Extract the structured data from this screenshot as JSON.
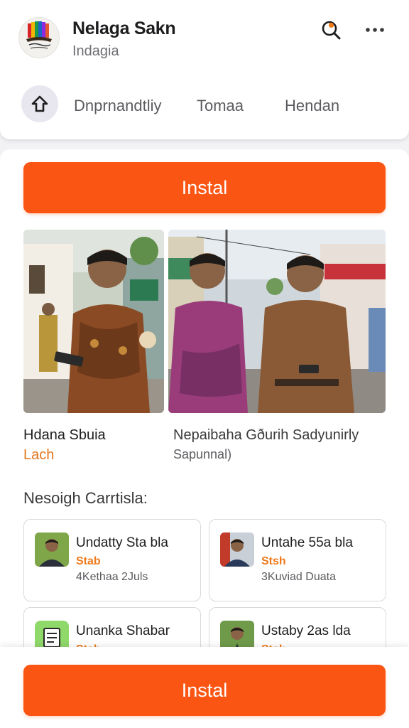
{
  "app": {
    "name": "Nelaga Sakn",
    "subtitle": "Indagia"
  },
  "header": {
    "icons": [
      "search-icon",
      "more-dots-icon"
    ],
    "tabs": [
      "Dnprnandtliy",
      "Tomaa",
      "Hendan"
    ],
    "home_icon": "home-up-icon"
  },
  "install_label": "Instal",
  "photos": [
    {
      "caption": "Hdana Sbuia",
      "sub": "Lach"
    },
    {
      "caption": "Nepaibaha Gðurih Sadyunirly",
      "sub": "Sapunnal)"
    }
  ],
  "section_title": "Nesoigh Carrtisla:",
  "cards": [
    {
      "title": "Undatty Sta bla",
      "tag": "Stab",
      "meta": "4Kethaa 2Juls",
      "thumb": "portrait"
    },
    {
      "title": "Untahe 55a bla",
      "tag": "Stsh",
      "meta": "3Kuviad Duata",
      "thumb": "portrait"
    },
    {
      "title": "Unanka Shabar",
      "tag": "Stsh",
      "meta": "",
      "thumb": "document-icon"
    },
    {
      "title": "Ustaby 2as lda",
      "tag": "Stsh",
      "meta": "",
      "thumb": "portrait"
    }
  ],
  "bottom_install_label": "Instal",
  "colors": {
    "accent": "#fa5513",
    "tag": "#f07a1a"
  }
}
